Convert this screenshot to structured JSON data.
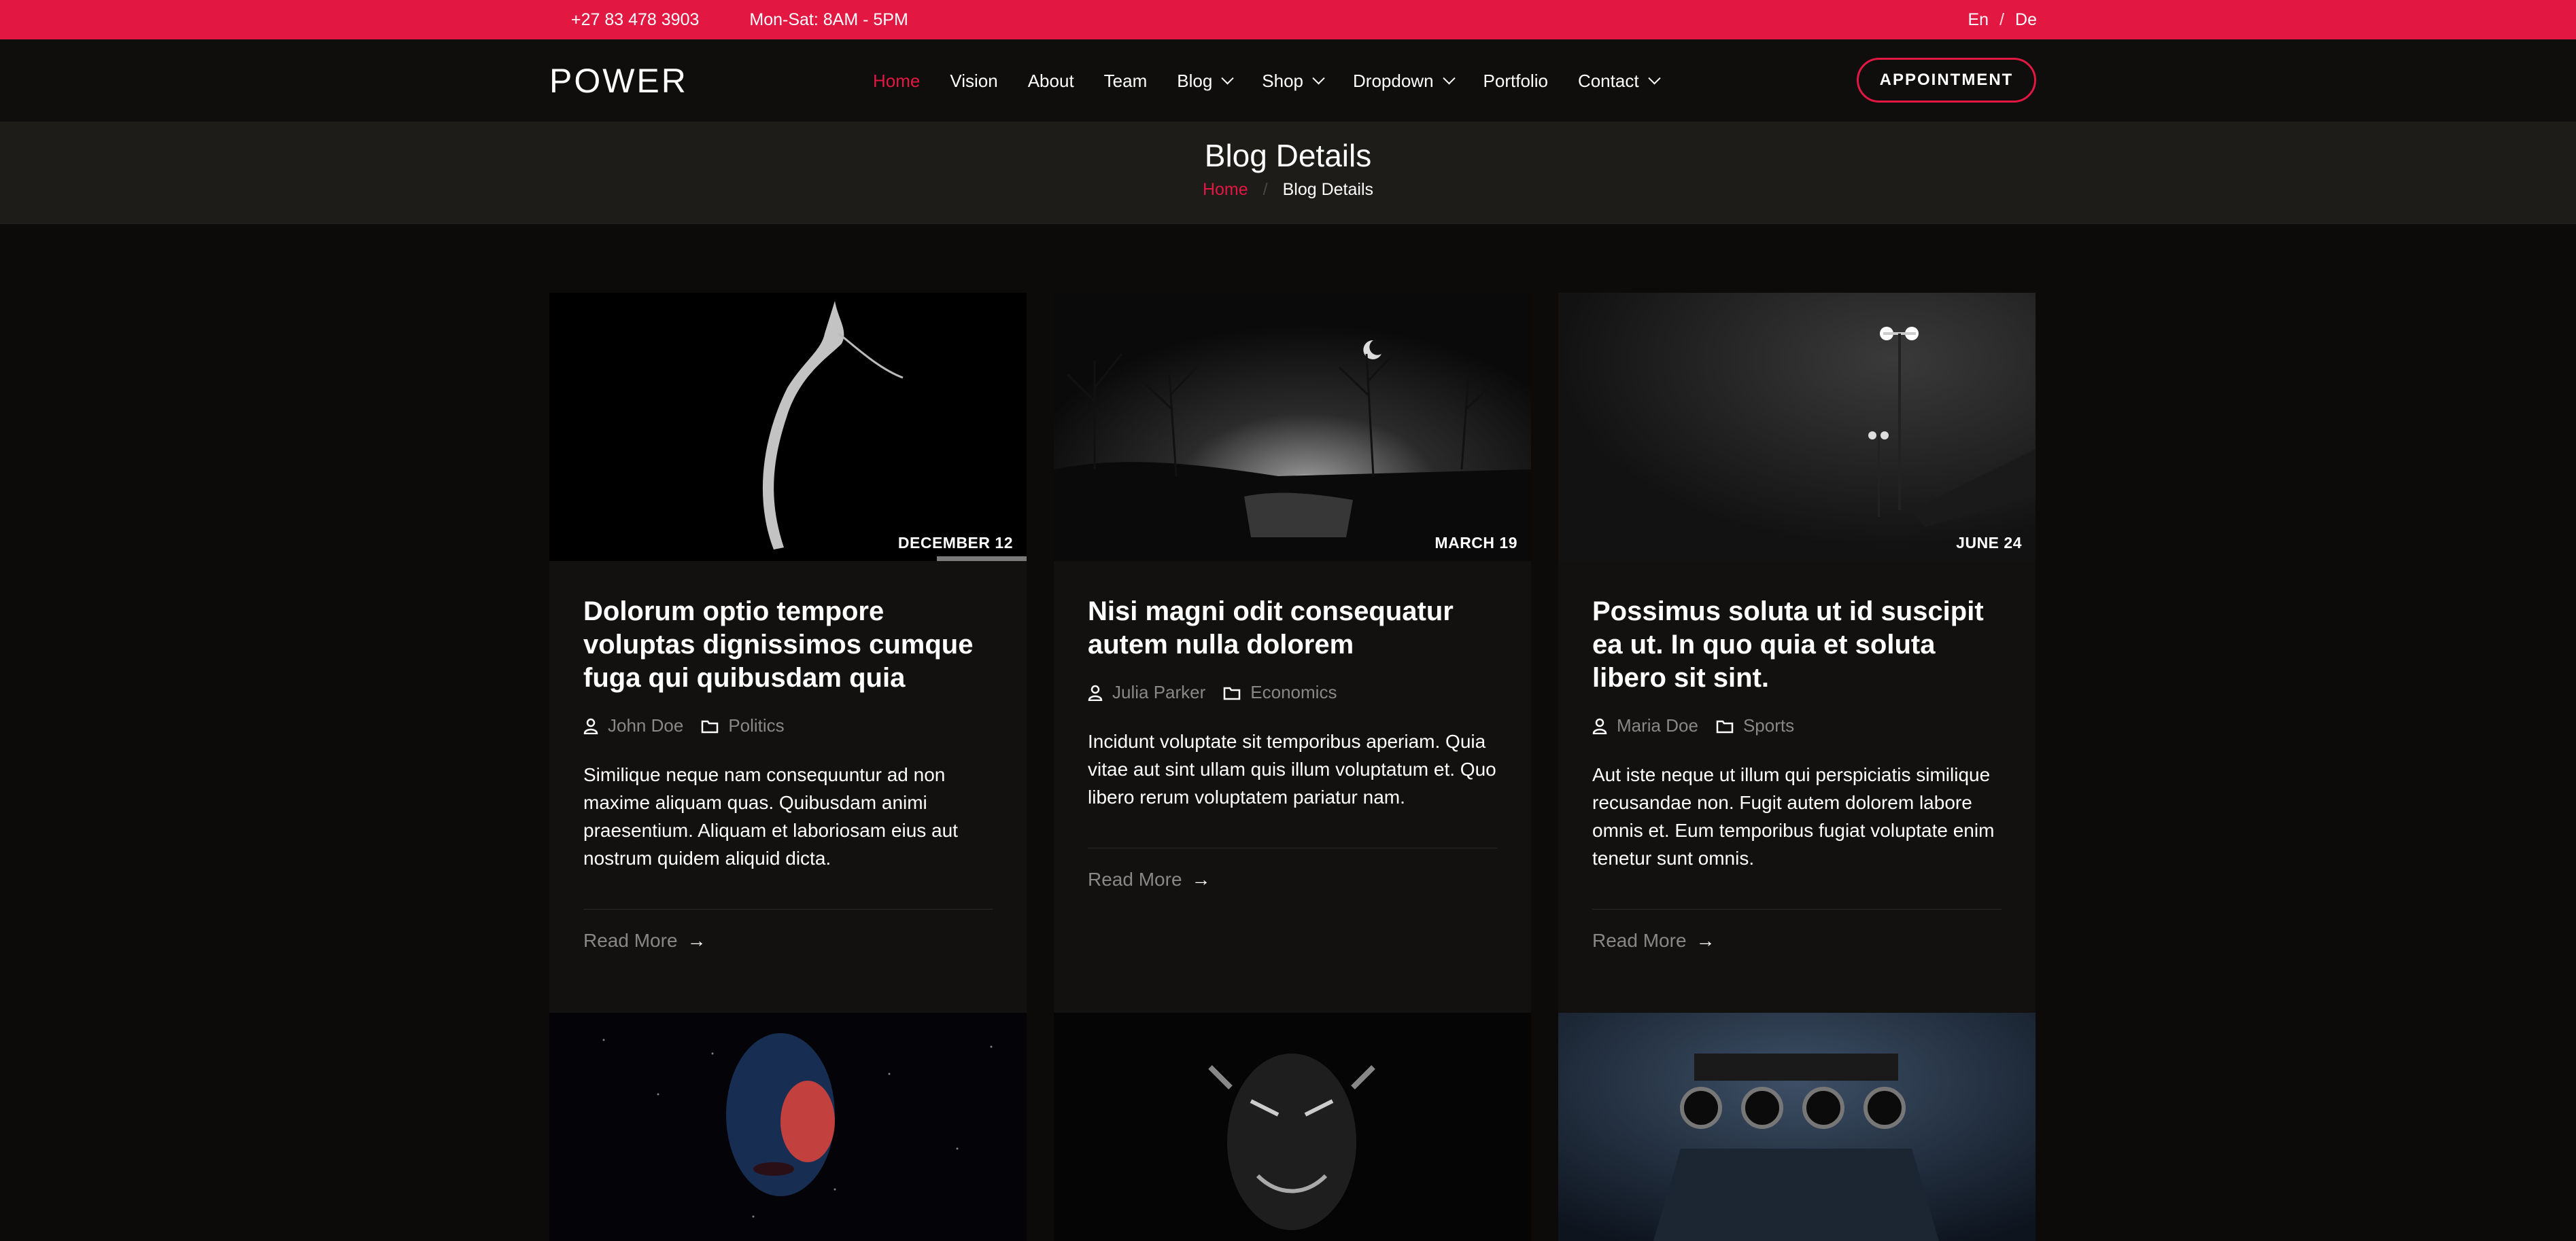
{
  "topbar": {
    "phone": "+27 83 478 3903",
    "hours": "Mon-Sat: 8AM - 5PM",
    "lang_en": "En",
    "lang_sep": "/",
    "lang_de": "De"
  },
  "header": {
    "logo": "POWER",
    "nav": [
      {
        "label": "Home",
        "active": true,
        "dropdown": false
      },
      {
        "label": "Vision",
        "dropdown": false
      },
      {
        "label": "About",
        "dropdown": false
      },
      {
        "label": "Team",
        "dropdown": false
      },
      {
        "label": "Blog",
        "dropdown": true
      },
      {
        "label": "Shop",
        "dropdown": true
      },
      {
        "label": "Dropdown",
        "dropdown": true
      },
      {
        "label": "Portfolio",
        "dropdown": false
      },
      {
        "label": "Contact",
        "dropdown": true
      }
    ],
    "appointment": "APPOINTMENT"
  },
  "page_title": {
    "title": "Blog Details",
    "crumb_home": "Home",
    "crumb_sep": "/",
    "crumb_current": "Blog Details"
  },
  "posts": [
    {
      "date": "DECEMBER 12",
      "title": "Dolorum optio tempore voluptas dignissimos cumque fuga qui quibusdam quia",
      "author": "John Doe",
      "category": "Politics",
      "excerpt": "Similique neque nam consequuntur ad non maxime aliquam quas. Quibusdam animi praesentium. Aliquam et laboriosam eius aut nostrum quidem aliquid dicta.",
      "read_more": "Read More"
    },
    {
      "date": "MARCH 19",
      "title": "Nisi magni odit consequatur autem nulla dolorem",
      "author": "Julia Parker",
      "category": "Economics",
      "excerpt": "Incidunt voluptate sit temporibus aperiam. Quia vitae aut sint ullam quis illum voluptatum et. Quo libero rerum voluptatem pariatur nam.",
      "read_more": "Read More"
    },
    {
      "date": "JUNE 24",
      "title": "Possimus soluta ut id suscipit ea ut. In quo quia et soluta libero sit sint.",
      "author": "Maria Doe",
      "category": "Sports",
      "excerpt": "Aut iste neque ut illum qui perspiciatis similique recusandae non. Fugit autem dolorem labore omnis et. Eum temporibus fugiat voluptate enim tenetur sunt omnis.",
      "read_more": "Read More"
    }
  ],
  "colors": {
    "accent": "#e21842",
    "background": "#0c0b0a",
    "card": "#121110",
    "muted_text": "#8a8886"
  }
}
